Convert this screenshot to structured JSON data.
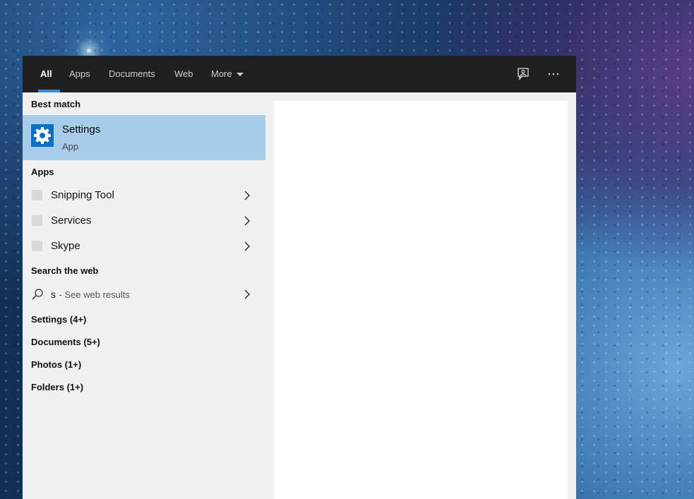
{
  "topbar": {
    "tabs": [
      {
        "label": "All"
      },
      {
        "label": "Apps"
      },
      {
        "label": "Documents"
      },
      {
        "label": "Web"
      },
      {
        "label": "More"
      }
    ],
    "active_tab": "All",
    "icons": [
      "feedback-icon",
      "more-options-icon"
    ]
  },
  "results": {
    "best_match_header": "Best match",
    "best_match": {
      "title": "Settings",
      "subtitle": "App",
      "icon": "gear-icon"
    },
    "apps_header": "Apps",
    "apps": [
      {
        "label": "Snipping Tool"
      },
      {
        "label": "Services"
      },
      {
        "label": "Skype"
      }
    ],
    "web_header": "Search the web",
    "web": {
      "query": "s",
      "suffix": "- See web results",
      "icon": "search-icon"
    },
    "categories": [
      {
        "label": "Settings (4+)"
      },
      {
        "label": "Documents (5+)"
      },
      {
        "label": "Photos (1+)"
      },
      {
        "label": "Folders (1+)"
      }
    ]
  },
  "colors": {
    "topbar": "#202020",
    "selected": "#a8cde9",
    "accent": "#0b6fc8",
    "underline": "#3a8ed8"
  }
}
